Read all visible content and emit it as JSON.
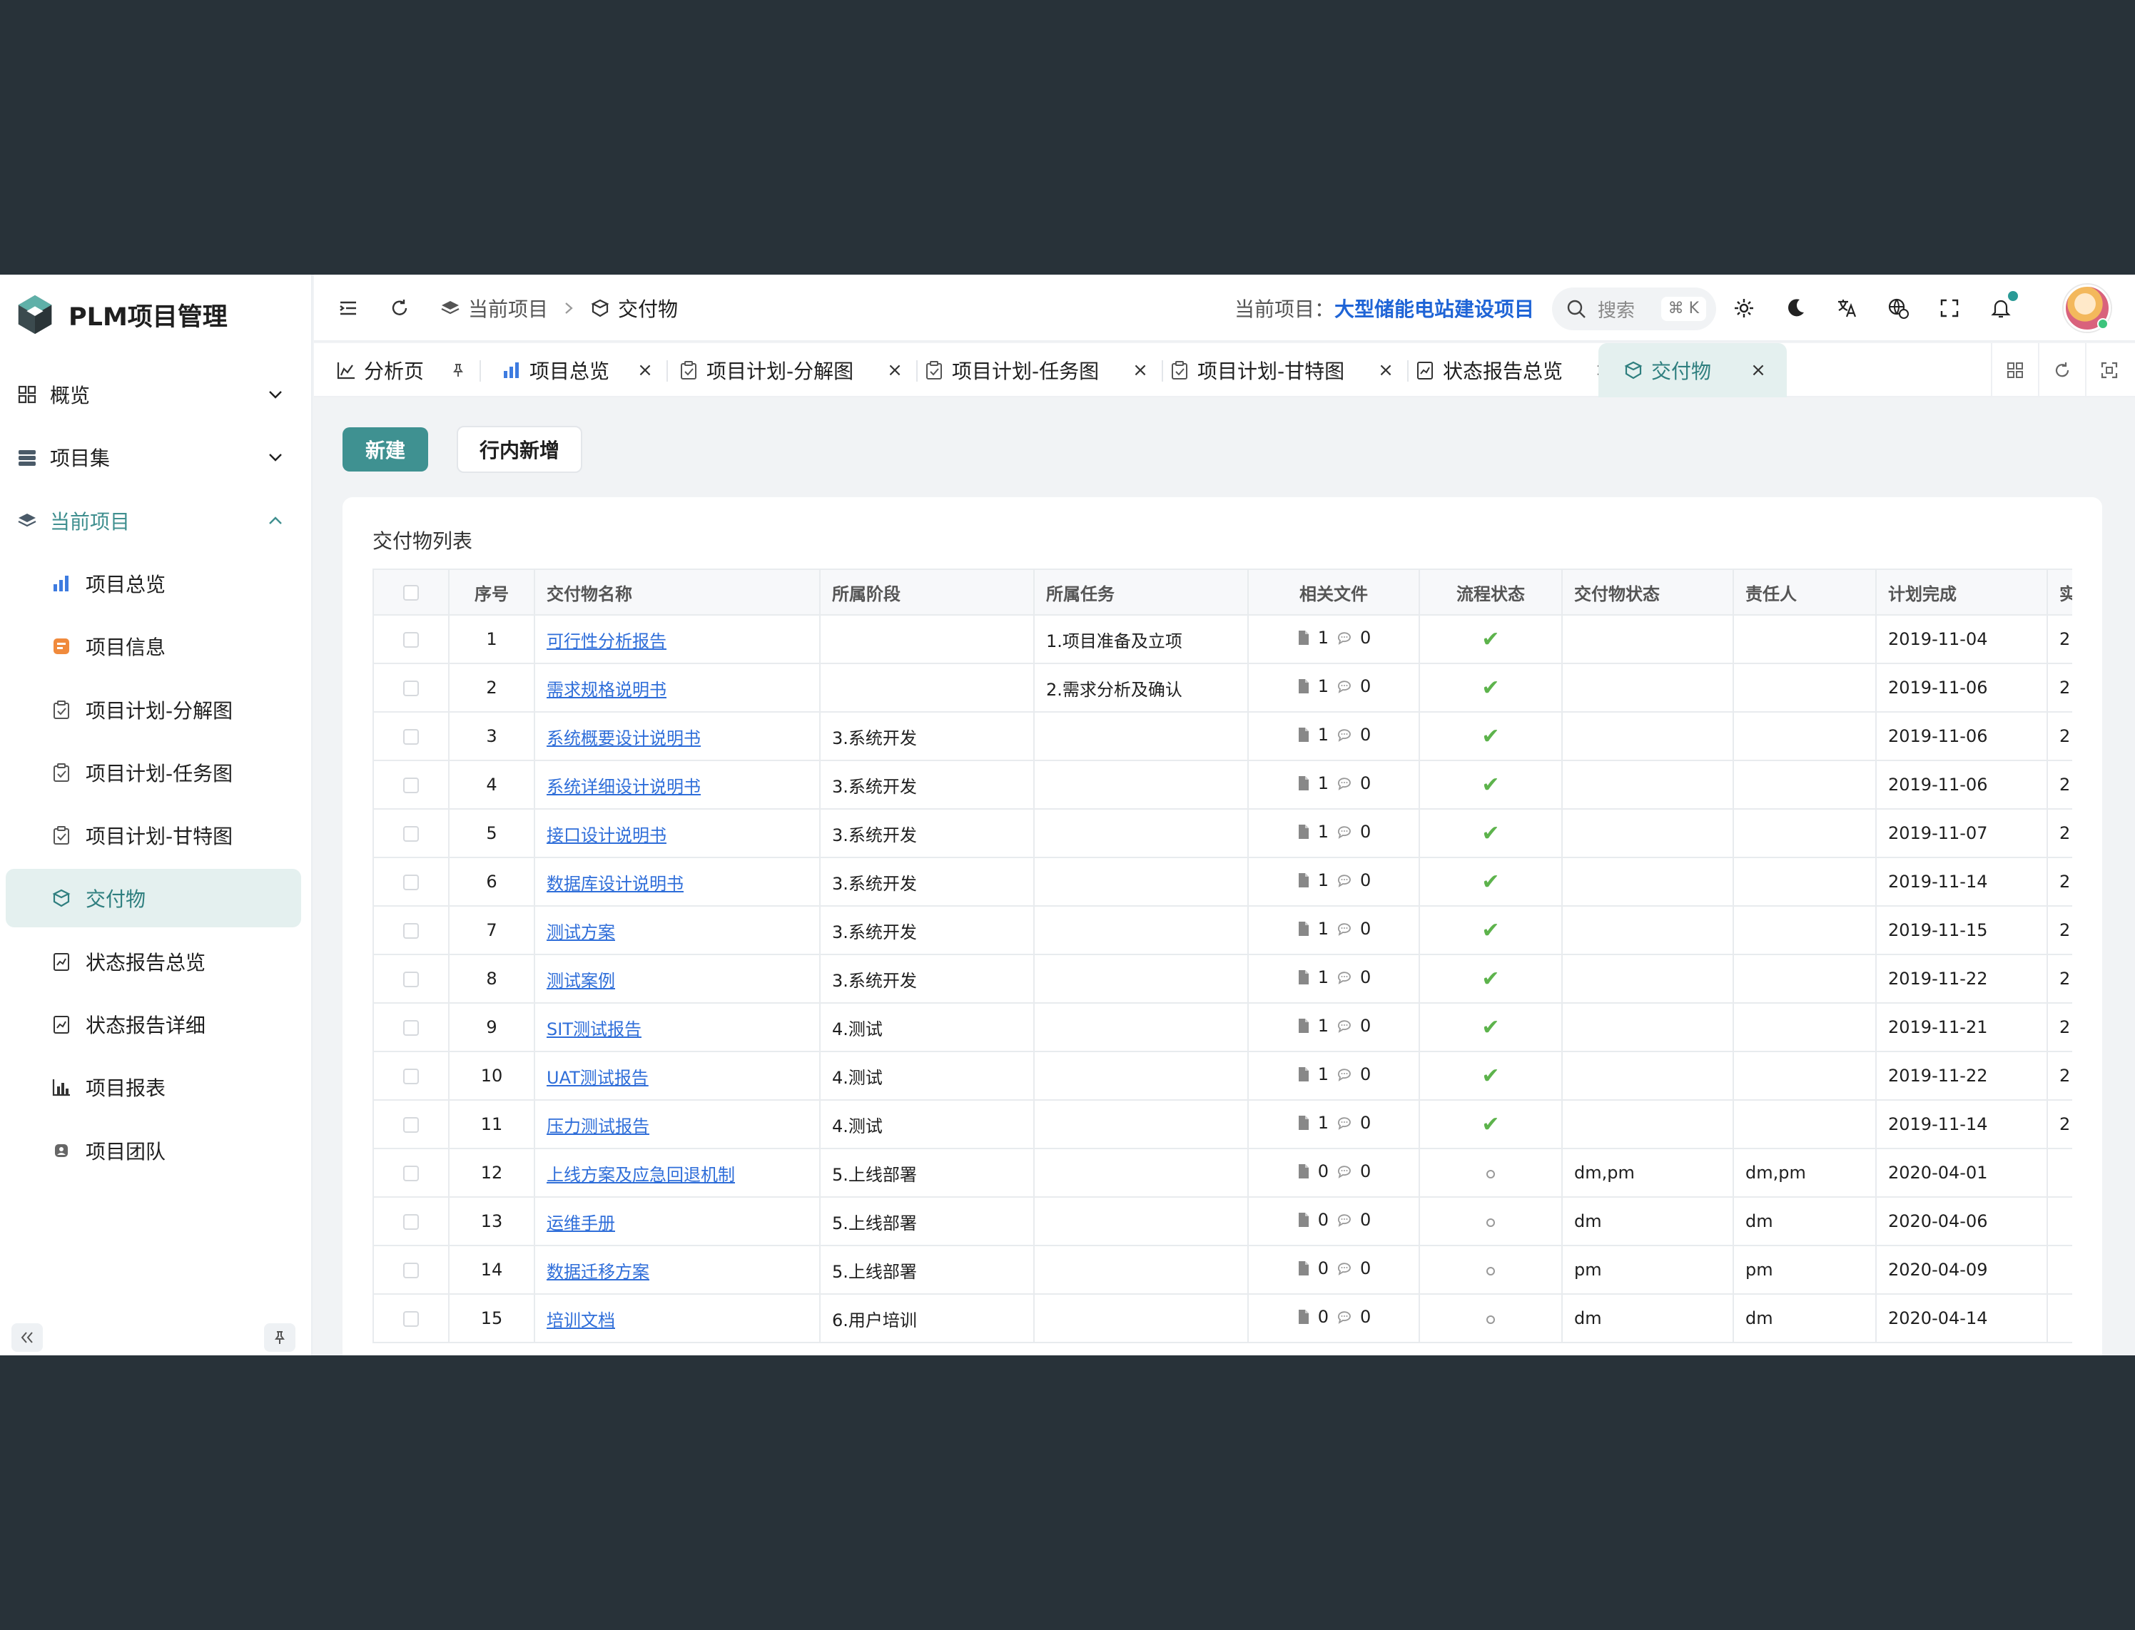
{
  "brand": {
    "title": "PLM项目管理"
  },
  "sidebar": {
    "items": [
      {
        "label": "概览",
        "icon": "dashboard-icon",
        "type": "top",
        "chevron": "down"
      },
      {
        "label": "项目集",
        "icon": "stack-icon",
        "type": "top",
        "chevron": "down"
      },
      {
        "label": "当前项目",
        "icon": "layers-icon",
        "type": "top",
        "chevron": "up",
        "active": true
      },
      {
        "label": "项目总览",
        "icon": "bar-chart-icon",
        "type": "sub"
      },
      {
        "label": "项目信息",
        "icon": "info-card-icon",
        "type": "sub"
      },
      {
        "label": "项目计划-分解图",
        "icon": "clipboard-check-icon",
        "type": "sub"
      },
      {
        "label": "项目计划-任务图",
        "icon": "clipboard-check-icon",
        "type": "sub"
      },
      {
        "label": "项目计划-甘特图",
        "icon": "clipboard-check-icon",
        "type": "sub"
      },
      {
        "label": "交付物",
        "icon": "deliverable-icon",
        "type": "sub",
        "selected": true
      },
      {
        "label": "状态报告总览",
        "icon": "report-icon",
        "type": "sub"
      },
      {
        "label": "状态报告详细",
        "icon": "report-icon",
        "type": "sub"
      },
      {
        "label": "项目报表",
        "icon": "column-chart-icon",
        "type": "sub"
      },
      {
        "label": "项目团队",
        "icon": "team-icon",
        "type": "sub"
      }
    ]
  },
  "header": {
    "breadcrumb": [
      "当前项目",
      "交付物"
    ],
    "current_project_label": "当前项目：",
    "current_project": "大型储能电站建设项目",
    "search_placeholder": "搜索",
    "search_shortcut": "⌘ K"
  },
  "tabs": [
    {
      "label": "分析页",
      "icon": "area-chart-icon",
      "closer": "pin"
    },
    {
      "label": "项目总览",
      "icon": "bar-chart-icon",
      "closer": "close"
    },
    {
      "label": "项目计划-分解图",
      "icon": "clipboard-check-icon",
      "closer": "close"
    },
    {
      "label": "项目计划-任务图",
      "icon": "clipboard-check-icon",
      "closer": "close"
    },
    {
      "label": "项目计划-甘特图",
      "icon": "clipboard-check-icon",
      "closer": "close"
    },
    {
      "label": "状态报告总览",
      "icon": "report-icon",
      "closer": "close"
    },
    {
      "label": "交付物",
      "icon": "deliverable-icon",
      "closer": "close",
      "active": true
    }
  ],
  "toolbar": {
    "new_label": "新建",
    "inline_add_label": "行内新增"
  },
  "table": {
    "title": "交付物列表",
    "columns": [
      "序号",
      "交付物名称",
      "所属阶段",
      "所属任务",
      "相关文件",
      "流程状态",
      "交付物状态",
      "责任人",
      "计划完成",
      "实"
    ],
    "rows": [
      {
        "no": "1",
        "name": "可行性分析报告",
        "phase": "",
        "task": "1.项目准备及立项",
        "files": "1",
        "comments": "0",
        "flow": "done",
        "status": "",
        "owner": "",
        "plan": "2019-11-04",
        "actual": "2"
      },
      {
        "no": "2",
        "name": "需求规格说明书",
        "phase": "",
        "task": "2.需求分析及确认",
        "files": "1",
        "comments": "0",
        "flow": "done",
        "status": "",
        "owner": "",
        "plan": "2019-11-06",
        "actual": "2"
      },
      {
        "no": "3",
        "name": "系统概要设计说明书",
        "phase": "3.系统开发",
        "task": "",
        "files": "1",
        "comments": "0",
        "flow": "done",
        "status": "",
        "owner": "",
        "plan": "2019-11-06",
        "actual": "2"
      },
      {
        "no": "4",
        "name": "系统详细设计说明书",
        "phase": "3.系统开发",
        "task": "",
        "files": "1",
        "comments": "0",
        "flow": "done",
        "status": "",
        "owner": "",
        "plan": "2019-11-06",
        "actual": "2"
      },
      {
        "no": "5",
        "name": "接口设计说明书",
        "phase": "3.系统开发",
        "task": "",
        "files": "1",
        "comments": "0",
        "flow": "done",
        "status": "",
        "owner": "",
        "plan": "2019-11-07",
        "actual": "2"
      },
      {
        "no": "6",
        "name": "数据库设计说明书",
        "phase": "3.系统开发",
        "task": "",
        "files": "1",
        "comments": "0",
        "flow": "done",
        "status": "",
        "owner": "",
        "plan": "2019-11-14",
        "actual": "2"
      },
      {
        "no": "7",
        "name": "测试方案",
        "phase": "3.系统开发",
        "task": "",
        "files": "1",
        "comments": "0",
        "flow": "done",
        "status": "",
        "owner": "",
        "plan": "2019-11-15",
        "actual": "2"
      },
      {
        "no": "8",
        "name": "测试案例",
        "phase": "3.系统开发",
        "task": "",
        "files": "1",
        "comments": "0",
        "flow": "done",
        "status": "",
        "owner": "",
        "plan": "2019-11-22",
        "actual": "2"
      },
      {
        "no": "9",
        "name": "SIT测试报告",
        "phase": "4.测试",
        "task": "",
        "files": "1",
        "comments": "0",
        "flow": "done",
        "status": "",
        "owner": "",
        "plan": "2019-11-21",
        "actual": "2"
      },
      {
        "no": "10",
        "name": "UAT测试报告",
        "phase": "4.测试",
        "task": "",
        "files": "1",
        "comments": "0",
        "flow": "done",
        "status": "",
        "owner": "",
        "plan": "2019-11-22",
        "actual": "2"
      },
      {
        "no": "11",
        "name": "压力测试报告",
        "phase": "4.测试",
        "task": "",
        "files": "1",
        "comments": "0",
        "flow": "done",
        "status": "",
        "owner": "",
        "plan": "2019-11-14",
        "actual": "2"
      },
      {
        "no": "12",
        "name": "上线方案及应急回退机制",
        "phase": "5.上线部署",
        "task": "",
        "files": "0",
        "comments": "0",
        "flow": "pending",
        "status": "dm,pm",
        "owner": "dm,pm",
        "plan": "2020-04-01",
        "actual": ""
      },
      {
        "no": "13",
        "name": "运维手册",
        "phase": "5.上线部署",
        "task": "",
        "files": "0",
        "comments": "0",
        "flow": "pending",
        "status": "dm",
        "owner": "dm",
        "plan": "2020-04-06",
        "actual": ""
      },
      {
        "no": "14",
        "name": "数据迁移方案",
        "phase": "5.上线部署",
        "task": "",
        "files": "0",
        "comments": "0",
        "flow": "pending",
        "status": "pm",
        "owner": "pm",
        "plan": "2020-04-09",
        "actual": ""
      },
      {
        "no": "15",
        "name": "培训文档",
        "phase": "6.用户培训",
        "task": "",
        "files": "0",
        "comments": "0",
        "flow": "pending",
        "status": "dm",
        "owner": "dm",
        "plan": "2020-04-14",
        "actual": ""
      }
    ]
  },
  "colors": {
    "primary": "#3f9191",
    "link": "#2f6ed9",
    "check": "#5db34c",
    "project": "#1f64d6"
  }
}
